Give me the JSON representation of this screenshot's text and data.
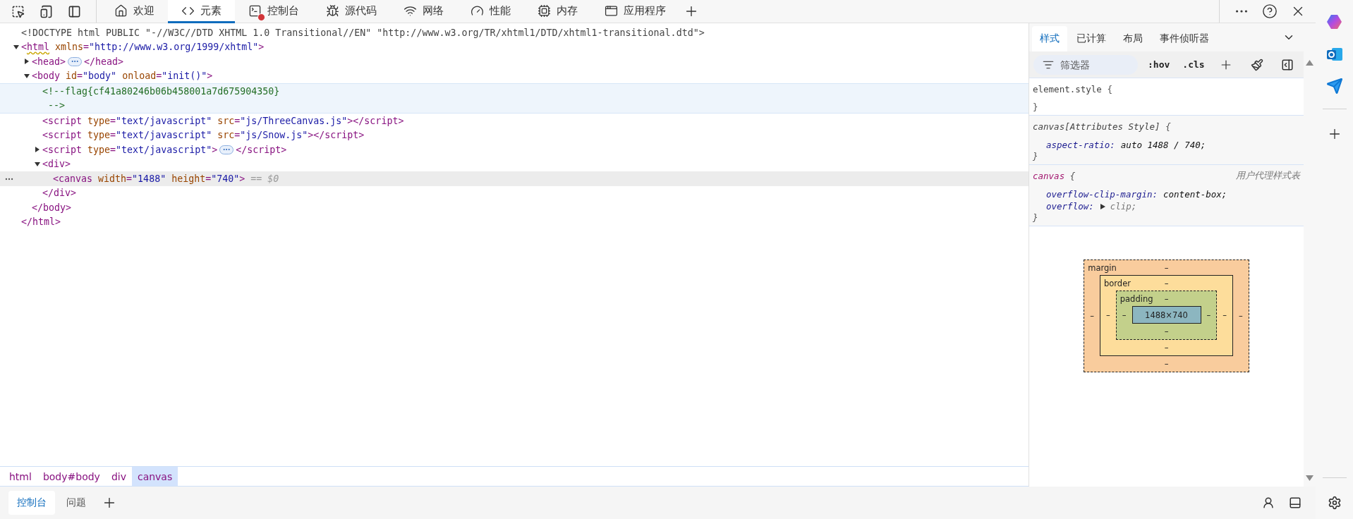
{
  "toolbar": {
    "left_tools": [
      {
        "kind": "inspect"
      },
      {
        "kind": "device"
      },
      {
        "kind": "dock"
      }
    ],
    "tabs": [
      {
        "label": "欢迎",
        "selected": false,
        "error": false
      },
      {
        "label": "元素",
        "selected": true,
        "error": false
      },
      {
        "label": "控制台",
        "selected": false,
        "error": true
      },
      {
        "label": "源代码",
        "selected": false,
        "error": false
      },
      {
        "label": "网络",
        "selected": false,
        "error": false
      },
      {
        "label": "性能",
        "selected": false,
        "error": false
      },
      {
        "label": "内存",
        "selected": false,
        "error": false
      },
      {
        "label": "应用程序",
        "selected": false,
        "error": false
      }
    ],
    "right_tools": [
      {
        "kind": "more"
      },
      {
        "kind": "help"
      },
      {
        "kind": "close"
      }
    ]
  },
  "dom_tree": [
    {
      "kind": "doctype",
      "selected": false,
      "hovered": false,
      "open": [
        {
          "kind": "doctype",
          "text": "<!DOCTYPE html PUBLIC \"-//W3C//DTD XHTML 1.0 Transitional//EN\" \"http://www.w3.org/TR/xhtml1/DTD/xhtml1-transitional.dtd\">"
        }
      ]
    },
    {
      "kind": "element",
      "selected": false,
      "hovered": false,
      "expanded": true,
      "warning": true,
      "open": [
        {
          "kind": "tag",
          "text": "<"
        },
        {
          "kind": "tagname",
          "text": "html"
        },
        {
          "kind": "attr",
          "text": " xmlns"
        },
        {
          "kind": "tag",
          "text": "="
        },
        {
          "kind": "value",
          "text": "\"http://www.w3.org/1999/xhtml\""
        },
        {
          "kind": "tag",
          "text": ">"
        }
      ],
      "close": [
        {
          "kind": "tag",
          "text": "</html>"
        }
      ],
      "children": [
        {
          "kind": "element",
          "selected": false,
          "hovered": false,
          "expanded": false,
          "warning": false,
          "open": [
            {
              "kind": "tag",
              "text": "<head>"
            }
          ],
          "close": [
            {
              "kind": "tag",
              "text": "</head>"
            }
          ]
        },
        {
          "kind": "element",
          "selected": false,
          "hovered": false,
          "expanded": true,
          "warning": false,
          "open": [
            {
              "kind": "tag",
              "text": "<body"
            },
            {
              "kind": "attr",
              "text": " id"
            },
            {
              "kind": "tag",
              "text": "="
            },
            {
              "kind": "value",
              "text": "\"body\""
            },
            {
              "kind": "attr",
              "text": " onload"
            },
            {
              "kind": "tag",
              "text": "="
            },
            {
              "kind": "value",
              "text": "\"init()\""
            },
            {
              "kind": "tag",
              "text": ">"
            }
          ],
          "close": [
            {
              "kind": "tag",
              "text": "</body>"
            }
          ],
          "children": [
            {
              "kind": "comment",
              "selected": false,
              "hovered": true,
              "lines": [
                "<!--flag{cf41a80246b06b458001a7d675904350}",
                " -->"
              ]
            },
            {
              "kind": "leaf",
              "selected": false,
              "hovered": false,
              "open": [
                {
                  "kind": "tag",
                  "text": "<script"
                },
                {
                  "kind": "attr",
                  "text": " type"
                },
                {
                  "kind": "tag",
                  "text": "="
                },
                {
                  "kind": "value",
                  "text": "\"text/javascript\""
                },
                {
                  "kind": "attr",
                  "text": " src"
                },
                {
                  "kind": "tag",
                  "text": "="
                },
                {
                  "kind": "value",
                  "text": "\"js/ThreeCanvas.js\""
                },
                {
                  "kind": "tag",
                  "text": "></script>"
                }
              ]
            },
            {
              "kind": "leaf",
              "selected": false,
              "hovered": false,
              "open": [
                {
                  "kind": "tag",
                  "text": "<script"
                },
                {
                  "kind": "attr",
                  "text": " type"
                },
                {
                  "kind": "tag",
                  "text": "="
                },
                {
                  "kind": "value",
                  "text": "\"text/javascript\""
                },
                {
                  "kind": "attr",
                  "text": " src"
                },
                {
                  "kind": "tag",
                  "text": "="
                },
                {
                  "kind": "value",
                  "text": "\"js/Snow.js\""
                },
                {
                  "kind": "tag",
                  "text": "></script>"
                }
              ]
            },
            {
              "kind": "element",
              "selected": false,
              "hovered": false,
              "expanded": false,
              "warning": false,
              "open": [
                {
                  "kind": "tag",
                  "text": "<script"
                },
                {
                  "kind": "attr",
                  "text": " type"
                },
                {
                  "kind": "tag",
                  "text": "="
                },
                {
                  "kind": "value",
                  "text": "\"text/javascript\""
                },
                {
                  "kind": "tag",
                  "text": ">"
                }
              ],
              "close": [
                {
                  "kind": "tag",
                  "text": "</script>"
                }
              ]
            },
            {
              "kind": "element",
              "selected": false,
              "hovered": false,
              "expanded": true,
              "warning": false,
              "open": [
                {
                  "kind": "tag",
                  "text": "<div>"
                }
              ],
              "close": [
                {
                  "kind": "tag",
                  "text": "</div>"
                }
              ],
              "children": [
                {
                  "kind": "leaf",
                  "selected": true,
                  "hovered": false,
                  "open": [
                    {
                      "kind": "tag",
                      "text": "<canvas"
                    },
                    {
                      "kind": "attr",
                      "text": " width"
                    },
                    {
                      "kind": "tag",
                      "text": "="
                    },
                    {
                      "kind": "value",
                      "text": "\"1488\""
                    },
                    {
                      "kind": "attr",
                      "text": " height"
                    },
                    {
                      "kind": "tag",
                      "text": "="
                    },
                    {
                      "kind": "value",
                      "text": "\"740\""
                    },
                    {
                      "kind": "tag",
                      "text": ">"
                    }
                  ],
                  "suffix": "== $0"
                }
              ]
            }
          ]
        }
      ]
    }
  ],
  "breadcrumbs": [
    {
      "label": "html",
      "selected": false
    },
    {
      "label": "body#body",
      "selected": false
    },
    {
      "label": "div",
      "selected": false
    },
    {
      "label": "canvas",
      "selected": true
    }
  ],
  "styles_panel": {
    "tabs": [
      {
        "label": "样式",
        "selected": true
      },
      {
        "label": "已计算",
        "selected": false
      },
      {
        "label": "布局",
        "selected": false
      },
      {
        "label": "事件侦听器",
        "selected": false
      }
    ],
    "filter": {
      "placeholder": "筛选器"
    },
    "buttons": [
      ":hov",
      ".cls"
    ],
    "rules": [
      {
        "selector": "element.style",
        "kind": "inline",
        "readonly": false,
        "open_brace": "{",
        "close_brace": "}"
      },
      {
        "selector": "canvas[Attributes Style]",
        "kind": "attributes",
        "readonly": true,
        "open_brace": "{",
        "close_brace": "}",
        "declarations": [
          {
            "property": "aspect-ratio:",
            "value": "auto 1488 / 740;",
            "expandable": false
          }
        ]
      },
      {
        "selector": "canvas",
        "kind": "tag",
        "readonly": true,
        "source": "用户代理样式表",
        "open_brace": "{",
        "close_brace": "}",
        "declarations": [
          {
            "property": "overflow-clip-margin:",
            "value": "content-box;",
            "expandable": false
          },
          {
            "property": "overflow:",
            "value": "clip;",
            "expandable": true
          }
        ]
      }
    ],
    "box_model": {
      "label": "margin",
      "top": "–",
      "left": "–",
      "right": "–",
      "bottom": "–",
      "inner": {
        "label": "border",
        "top": "–",
        "left": "–",
        "right": "–",
        "bottom": "–",
        "inner": {
          "label": "padding",
          "top": "–",
          "left": "–",
          "right": "–",
          "bottom": "–",
          "content": "1488×740"
        }
      }
    }
  },
  "drawer": {
    "tabs": [
      {
        "label": "控制台",
        "selected": true
      },
      {
        "label": "问题",
        "selected": false
      }
    ]
  },
  "edge_sidebar": {
    "apps": [
      {
        "kind": "copilot"
      },
      {
        "kind": "outlook"
      },
      {
        "kind": "send"
      }
    ]
  }
}
